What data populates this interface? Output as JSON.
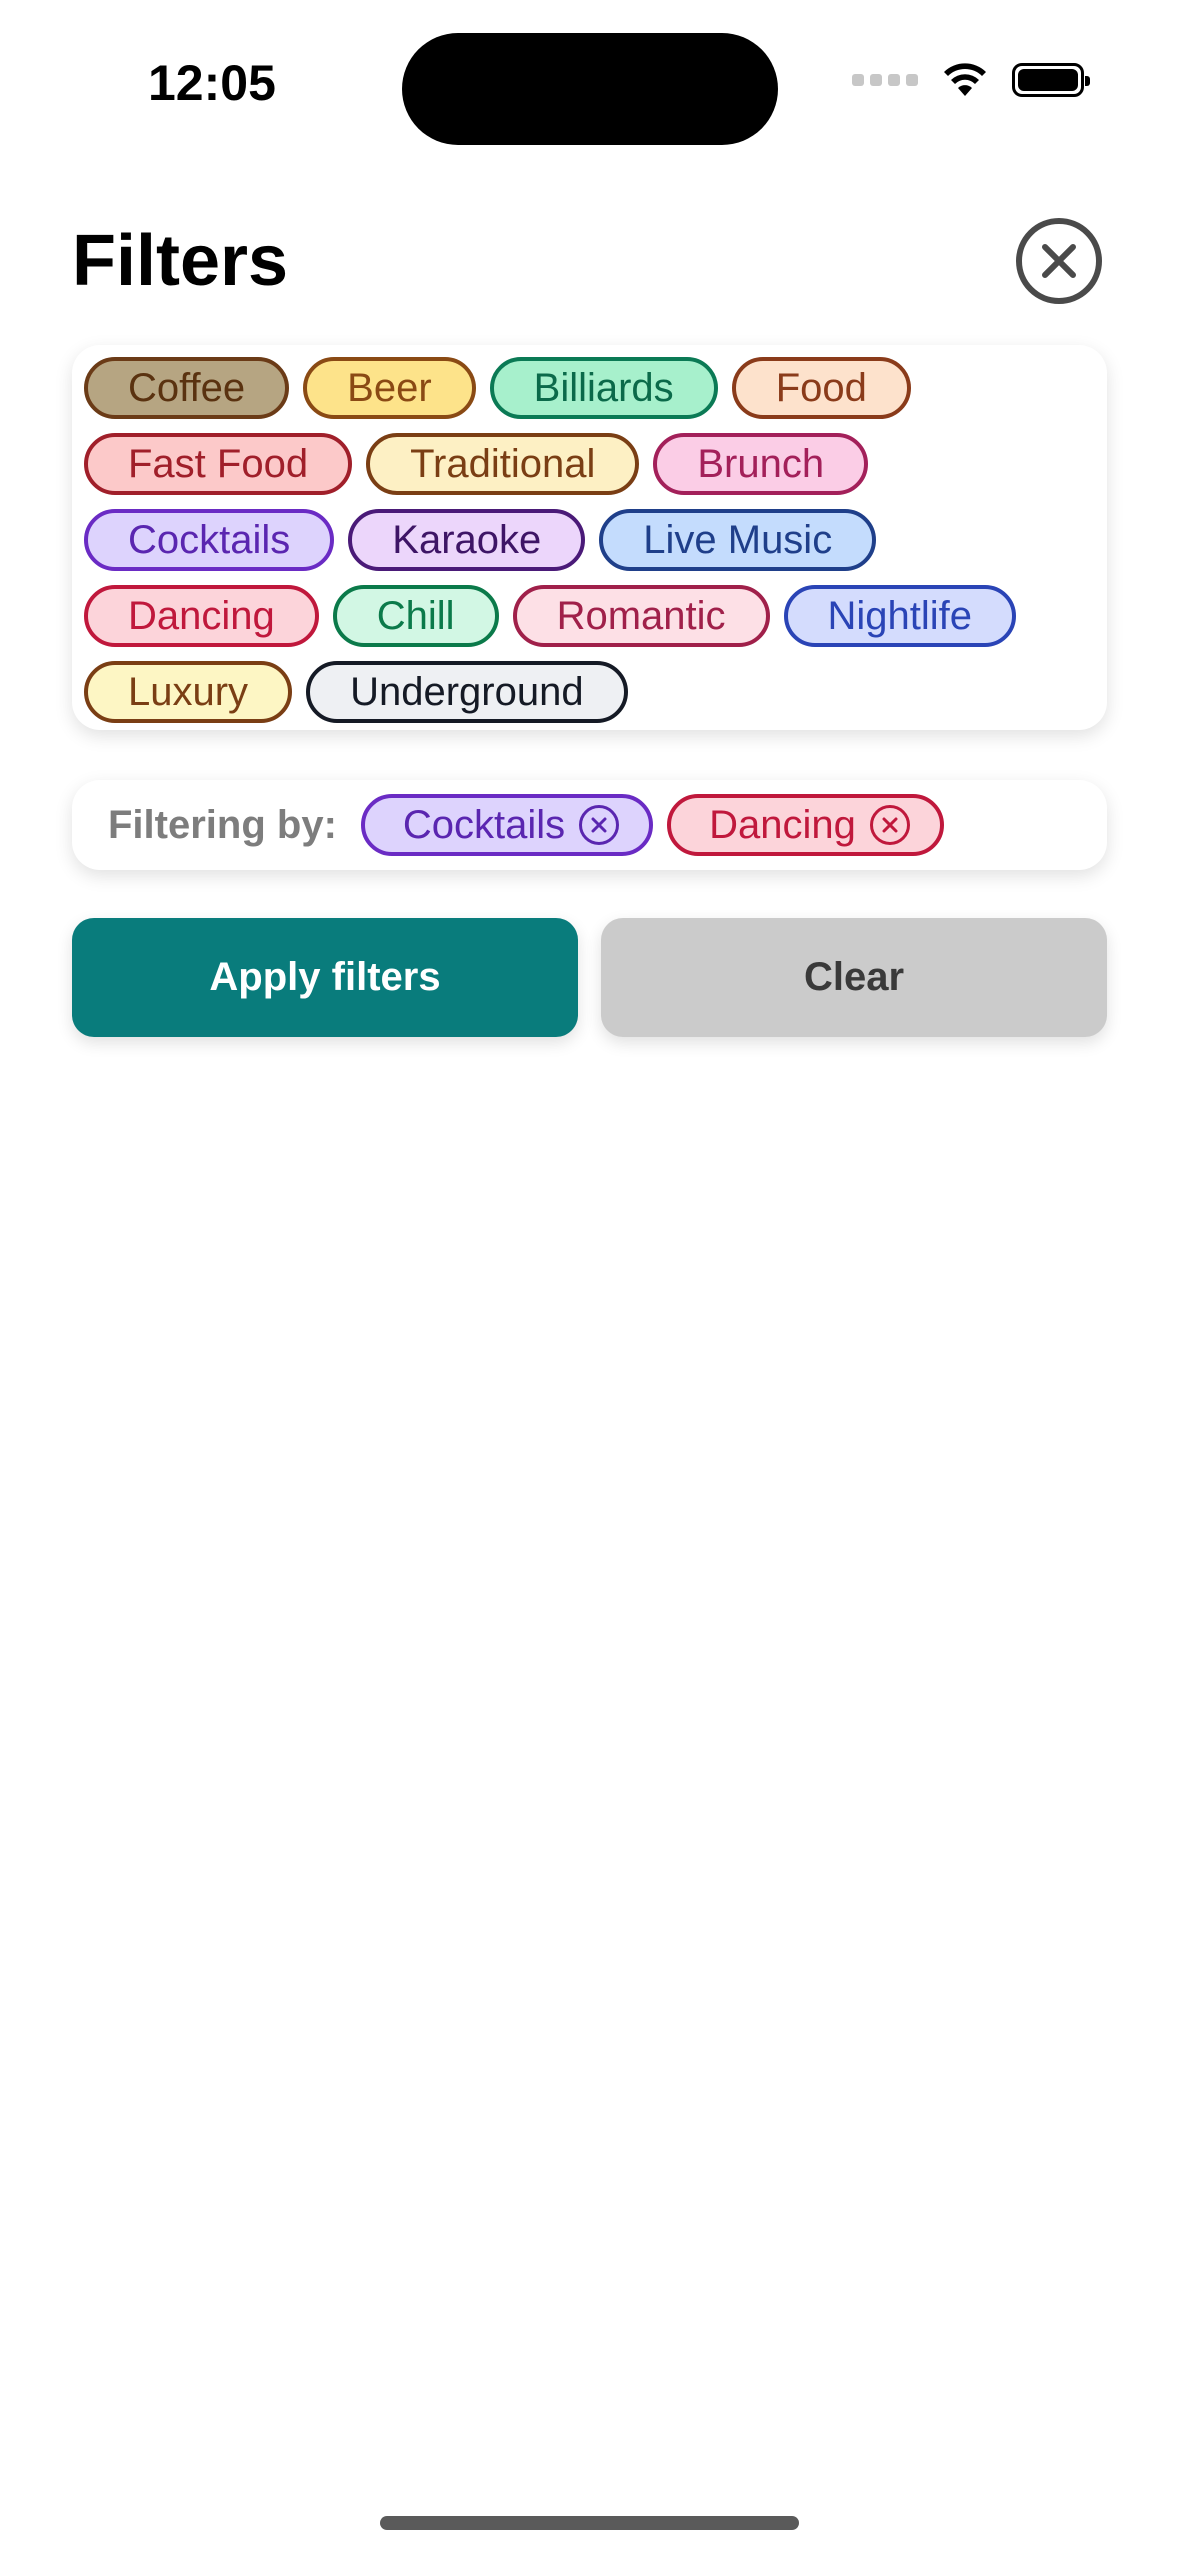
{
  "status_bar": {
    "time": "12:05"
  },
  "header": {
    "title": "Filters"
  },
  "tags": [
    {
      "label": "Coffee",
      "bg": "#b6a582",
      "border": "#6b3b17",
      "text": "#5a3210"
    },
    {
      "label": "Beer",
      "bg": "#fde38a",
      "border": "#8a4a14",
      "text": "#8a4a14"
    },
    {
      "label": "Billiards",
      "bg": "#a7f0cc",
      "border": "#0b7a55",
      "text": "#0b6a4a"
    },
    {
      "label": "Food",
      "bg": "#fde2cc",
      "border": "#8a3b1a",
      "text": "#8a3b1a"
    },
    {
      "label": "Fast Food",
      "bg": "#fcc9c9",
      "border": "#a01f2a",
      "text": "#a01f2a"
    },
    {
      "label": "Traditional",
      "bg": "#fdf0c4",
      "border": "#7a3e14",
      "text": "#7a3e14"
    },
    {
      "label": "Brunch",
      "bg": "#fbcde6",
      "border": "#a3205a",
      "text": "#a3205a"
    },
    {
      "label": "Cocktails",
      "bg": "#ddd3fd",
      "border": "#6a2bc4",
      "text": "#5a26b0"
    },
    {
      "label": "Karaoke",
      "bg": "#ecd6fb",
      "border": "#4a1a78",
      "text": "#3e1566"
    },
    {
      "label": "Live Music",
      "bg": "#c4dcfd",
      "border": "#1f3f8a",
      "text": "#1f3f8a"
    },
    {
      "label": "Dancing",
      "bg": "#fcd4da",
      "border": "#c0183c",
      "text": "#c0183c"
    },
    {
      "label": "Chill",
      "bg": "#d2f7e4",
      "border": "#0b7a4a",
      "text": "#0b7a4a"
    },
    {
      "label": "Romantic",
      "bg": "#fde0e6",
      "border": "#a0204a",
      "text": "#a0204a"
    },
    {
      "label": "Nightlife",
      "bg": "#d4dcfd",
      "border": "#2a44b6",
      "text": "#2a44b6"
    },
    {
      "label": "Luxury",
      "bg": "#fdf6c4",
      "border": "#7a3e14",
      "text": "#7a3e14"
    },
    {
      "label": "Underground",
      "bg": "#eef0f3",
      "border": "#151a25",
      "text": "#151a25"
    }
  ],
  "filtering": {
    "label": "Filtering by:",
    "active": [
      {
        "label": "Cocktails",
        "bg": "#ddd3fd",
        "border": "#6a2bc4",
        "text": "#5a26b0"
      },
      {
        "label": "Dancing",
        "bg": "#fcd4da",
        "border": "#c0183c",
        "text": "#c0183c"
      }
    ]
  },
  "actions": {
    "apply_label": "Apply filters",
    "clear_label": "Clear",
    "apply_color": "#097c7c",
    "clear_color": "#cbcbcb"
  }
}
